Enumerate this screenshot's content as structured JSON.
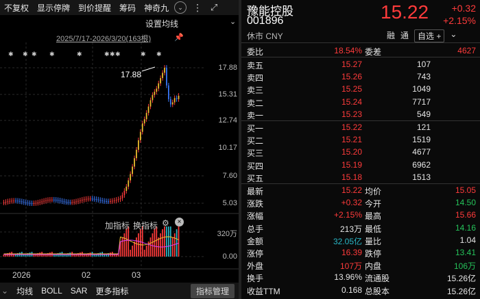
{
  "toolbar": {
    "items": [
      "不复权",
      "显示停牌",
      "到价提醒",
      "筹码",
      "神奇九"
    ],
    "icons": [
      "chevron-down-icon",
      "more-icon",
      "expand-icon"
    ]
  },
  "chart": {
    "settings_label": "设置均线",
    "range_label": "2025/7/17-2026/3/20(163根)",
    "y_ticks": [
      "17.88",
      "15.31",
      "12.74",
      "10.17",
      "7.60",
      "5.03"
    ],
    "peak_label": "17.88",
    "indicator_labels": [
      "加指标",
      "换指标"
    ],
    "vol_ticks": [
      "320万",
      "0.00"
    ],
    "x_ticks": [
      "2026",
      "02",
      "03"
    ],
    "bottom_items": [
      "均线",
      "BOLL",
      "SAR",
      "更多指标"
    ],
    "bottom_btn": "指标管理"
  },
  "stock": {
    "name": "豫能控股",
    "code": "001896",
    "status": "休市 CNY",
    "price": "15.22",
    "change": "+0.32",
    "change_pct": "+2.15%",
    "btn_margin": "融",
    "btn_short": "通",
    "btn_watch": "自选 +"
  },
  "orderbook": {
    "ratio_label": "委比",
    "ratio": "18.54%",
    "diff_label": "委差",
    "diff": "4627",
    "asks": [
      {
        "label": "卖五",
        "price": "15.27",
        "vol": "107"
      },
      {
        "label": "卖四",
        "price": "15.26",
        "vol": "743"
      },
      {
        "label": "卖三",
        "price": "15.25",
        "vol": "1049"
      },
      {
        "label": "卖二",
        "price": "15.24",
        "vol": "7717"
      },
      {
        "label": "卖一",
        "price": "15.23",
        "vol": "549"
      }
    ],
    "bids": [
      {
        "label": "买一",
        "price": "15.22",
        "vol": "121"
      },
      {
        "label": "买二",
        "price": "15.21",
        "vol": "1519"
      },
      {
        "label": "买三",
        "price": "15.20",
        "vol": "4677"
      },
      {
        "label": "买四",
        "price": "15.19",
        "vol": "6962"
      },
      {
        "label": "买五",
        "price": "15.18",
        "vol": "1513"
      }
    ]
  },
  "stats": [
    {
      "l1": "最新",
      "v1": "15.22",
      "c1": "red",
      "l2": "均价",
      "v2": "15.05",
      "c2": "red"
    },
    {
      "l1": "涨跌",
      "v1": "+0.32",
      "c1": "red",
      "l2": "今开",
      "v2": "14.50",
      "c2": "green"
    },
    {
      "l1": "涨幅",
      "v1": "+2.15%",
      "c1": "red",
      "l2": "最高",
      "v2": "15.66",
      "c2": "red"
    },
    {
      "l1": "总手",
      "v1": "213万",
      "c1": "white",
      "l2": "最低",
      "v2": "14.16",
      "c2": "green"
    },
    {
      "l1": "金额",
      "v1": "32.05亿",
      "c1": "cyan",
      "l2": "量比",
      "v2": "1.04",
      "c2": "white"
    },
    {
      "l1": "涨停",
      "v1": "16.39",
      "c1": "red",
      "l2": "跌停",
      "v2": "13.41",
      "c2": "green"
    },
    {
      "l1": "外盘",
      "v1": "107万",
      "c1": "red",
      "l2": "内盘",
      "v2": "106万",
      "c2": "green"
    },
    {
      "l1": "换手",
      "v1": "13.96%",
      "c1": "white",
      "l2": "流通股",
      "v2": "15.26亿",
      "c2": "white"
    },
    {
      "l1": "收益TTM",
      "v1": "0.168",
      "c1": "white",
      "l2": "总股本",
      "v2": "15.26亿",
      "c2": "white"
    }
  ],
  "colors": {
    "up": "#ff3b3b",
    "down": "#25c35a",
    "ma5": "#ffffff",
    "ma10": "#f2c230",
    "ma20": "#e040fb"
  }
}
